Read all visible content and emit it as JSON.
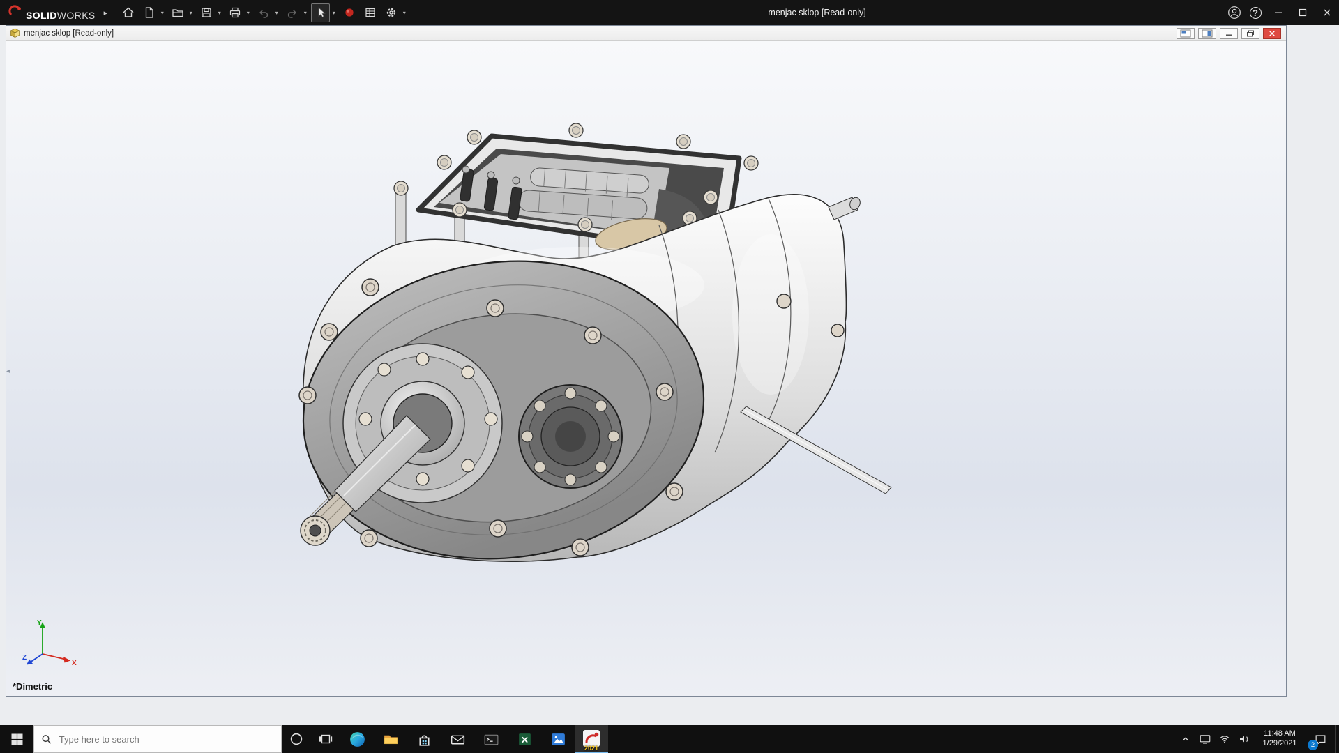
{
  "app": {
    "brand_solid": "SOLID",
    "brand_works": "WORKS",
    "title": "menjac sklop [Read-only]"
  },
  "glyphs": {
    "dropdown": "▾",
    "flyout": "▸",
    "collapse_left": "◂",
    "help": "?"
  },
  "doc": {
    "title": "menjac sklop [Read-only]"
  },
  "viewport": {
    "view_label": "*Dimetric",
    "axes": {
      "x": "X",
      "y": "Y",
      "z": "Z"
    }
  },
  "taskbar": {
    "search_placeholder": "Type here to search",
    "solidworks_year": "2021"
  },
  "tray": {
    "time": "11:48 AM",
    "date": "1/29/2021",
    "notification_count": "2"
  }
}
